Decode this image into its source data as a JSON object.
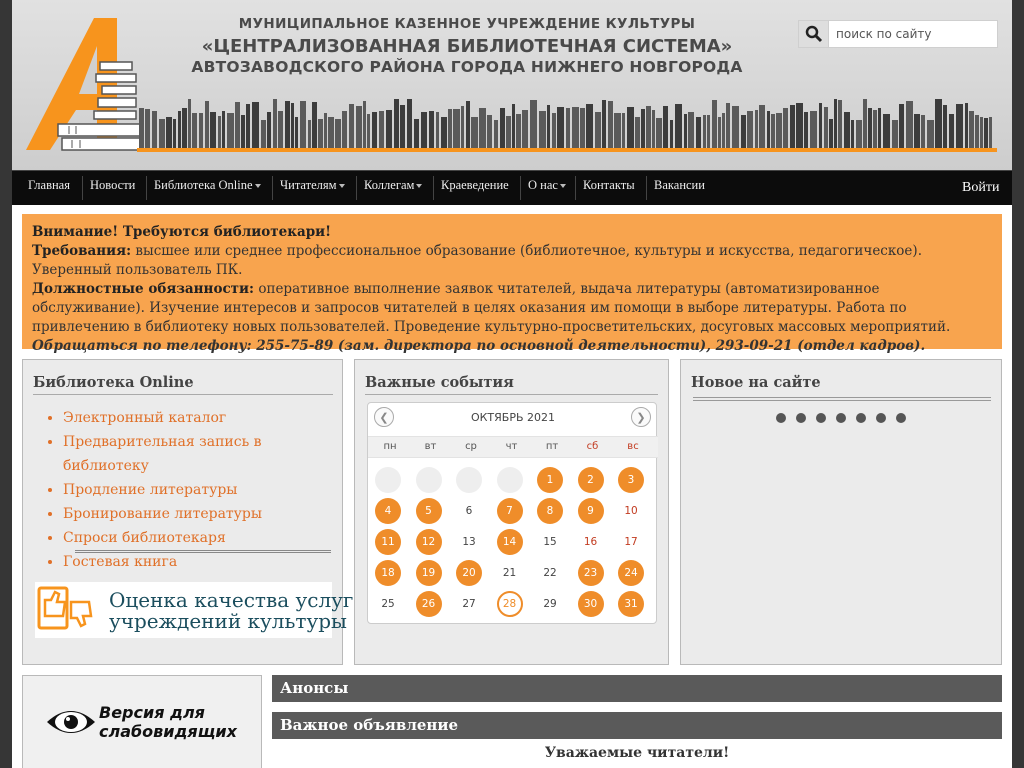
{
  "header": {
    "org_line1": "МУНИЦИПАЛЬНОЕ КАЗЕННОЕ УЧРЕЖДЕНИЕ КУЛЬТУРЫ",
    "org_line2": "«ЦЕНТРАЛИЗОВАННАЯ БИБЛИОТЕЧНАЯ СИСТЕМА»",
    "org_line3": "АВТОЗАВОДСКОГО РАЙОНА ГОРОДА НИЖНЕГО НОВГОРОДА",
    "logo_letter": "А"
  },
  "search": {
    "placeholder": "поиск по сайту",
    "icon": "search-icon"
  },
  "nav": {
    "items": [
      {
        "label": "Главная"
      },
      {
        "label": "Новости"
      },
      {
        "label": "Библиотека Online",
        "dropdown": true
      },
      {
        "label": "Читателям",
        "dropdown": true
      },
      {
        "label": "Коллегам",
        "dropdown": true
      },
      {
        "label": "Краеведение"
      },
      {
        "label": "О нас",
        "dropdown": true
      },
      {
        "label": "Контакты"
      },
      {
        "label": "Вакансии"
      }
    ],
    "login": "Войти"
  },
  "notice": {
    "title": "Внимание! Требуются библиотекари!",
    "req_label": "Требования:",
    "req_text": " высшее или среднее профессиональное образование (библиотечное, культуры и искусства, педагогическое). Уверенный пользователь ПК.",
    "duties_label": "Должностные обязанности:",
    "duties_text": " оперативное выполнение заявок читателей, выдача литературы (автоматизированное обслуживание). Изучение интересов и запросов читателей в целях оказания им помощи в выборе литературы. Работа по привлечению в библиотеку новых пользователей. Проведение культурно-просветительских, досуговых массовых мероприятий.",
    "contact": "Обращаться по телефону: 255-75-89 (зам. директора по основной деятельности), 293-09-21 (отдел кадров)."
  },
  "library_online": {
    "title": "Библиотека Online",
    "links": [
      "Электронный каталог",
      "Предварительная запись в библиотеку",
      "Продление литературы",
      "Бронирование литературы",
      "Спроси библиотекаря",
      "Гостевая книга"
    ],
    "banner_line1": "Оценка качества услуг",
    "banner_line2": "учреждений культуры"
  },
  "events": {
    "title": "Важные события",
    "month": "ОКТЯБРЬ 2021",
    "weekdays": [
      "пн",
      "вт",
      "ср",
      "чт",
      "пт",
      "сб",
      "вс"
    ],
    "weeks": [
      [
        "",
        "",
        "",
        "",
        "1",
        "2",
        "3"
      ],
      [
        "4",
        "5",
        "6",
        "7",
        "8",
        "9",
        "10"
      ],
      [
        "11",
        "12",
        "13",
        "14",
        "15",
        "16",
        "17"
      ],
      [
        "18",
        "19",
        "20",
        "21",
        "22",
        "23",
        "24"
      ],
      [
        "25",
        "26",
        "27",
        "28",
        "29",
        "30",
        "31"
      ]
    ],
    "event_days": [
      1,
      2,
      3,
      4,
      5,
      7,
      8,
      9,
      11,
      12,
      14,
      18,
      19,
      20,
      23,
      24,
      26,
      30,
      31
    ],
    "today": 28,
    "accent_color": "#ef8d2a"
  },
  "new_on_site": {
    "title": "Новое на сайте",
    "slide_count": 7
  },
  "accessibility": {
    "line1": "Версия для",
    "line2": "слабовидящих",
    "icon": "eye-icon"
  },
  "sections": {
    "announcements": "Анонсы",
    "important_notice": "Важное объявление",
    "notice_greeting": "Уважаемые читатели!"
  },
  "colors": {
    "accent": "#f7941d",
    "notice_bg": "#f8a44e",
    "nav_bg": "#0c0c0c"
  }
}
